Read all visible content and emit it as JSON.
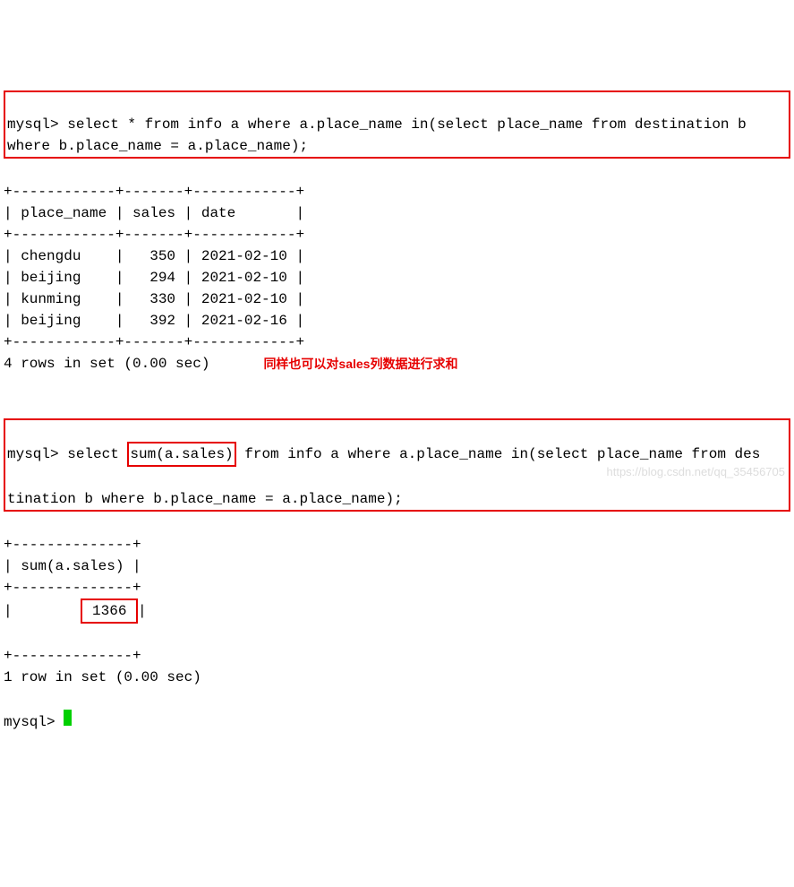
{
  "query1": {
    "prompt": "mysql>",
    "sql_line1": " select * from info a where a.place_name in(select place_name from destination b",
    "sql_line2": "where b.place_name = a.place_name);"
  },
  "table1": {
    "border_top": "+------------+-------+------------+",
    "header": "| place_name | sales | date       |",
    "border_mid": "+------------+-------+------------+",
    "rows": [
      "| chengdu    |   350 | 2021-02-10 |",
      "| beijing    |   294 | 2021-02-10 |",
      "| kunming    |   330 | 2021-02-10 |",
      "| beijing    |   392 | 2021-02-16 |"
    ],
    "border_bot": "+------------+-------+------------+",
    "summary": "4 rows in set (0.00 sec)"
  },
  "annotation": "同样也可以对sales列数据进行求和",
  "query2": {
    "prompt": "mysql>",
    "pre_highlight": " select ",
    "highlight": "sum(a.sales)",
    "post_highlight_line1": " from info a where a.place_name in(select place_name from des",
    "line2": "tination b where b.place_name = a.place_name);"
  },
  "table2": {
    "border_top": "+--------------+",
    "header": "| sum(a.sales) |",
    "border_mid": "+--------------+",
    "row_pre": "|        ",
    "row_val": " 1366 ",
    "row_post": "|",
    "border_bot": "+--------------+",
    "summary": "1 row in set (0.00 sec)"
  },
  "final_prompt": "mysql> ",
  "watermark": "https://blog.csdn.net/qq_35456705"
}
